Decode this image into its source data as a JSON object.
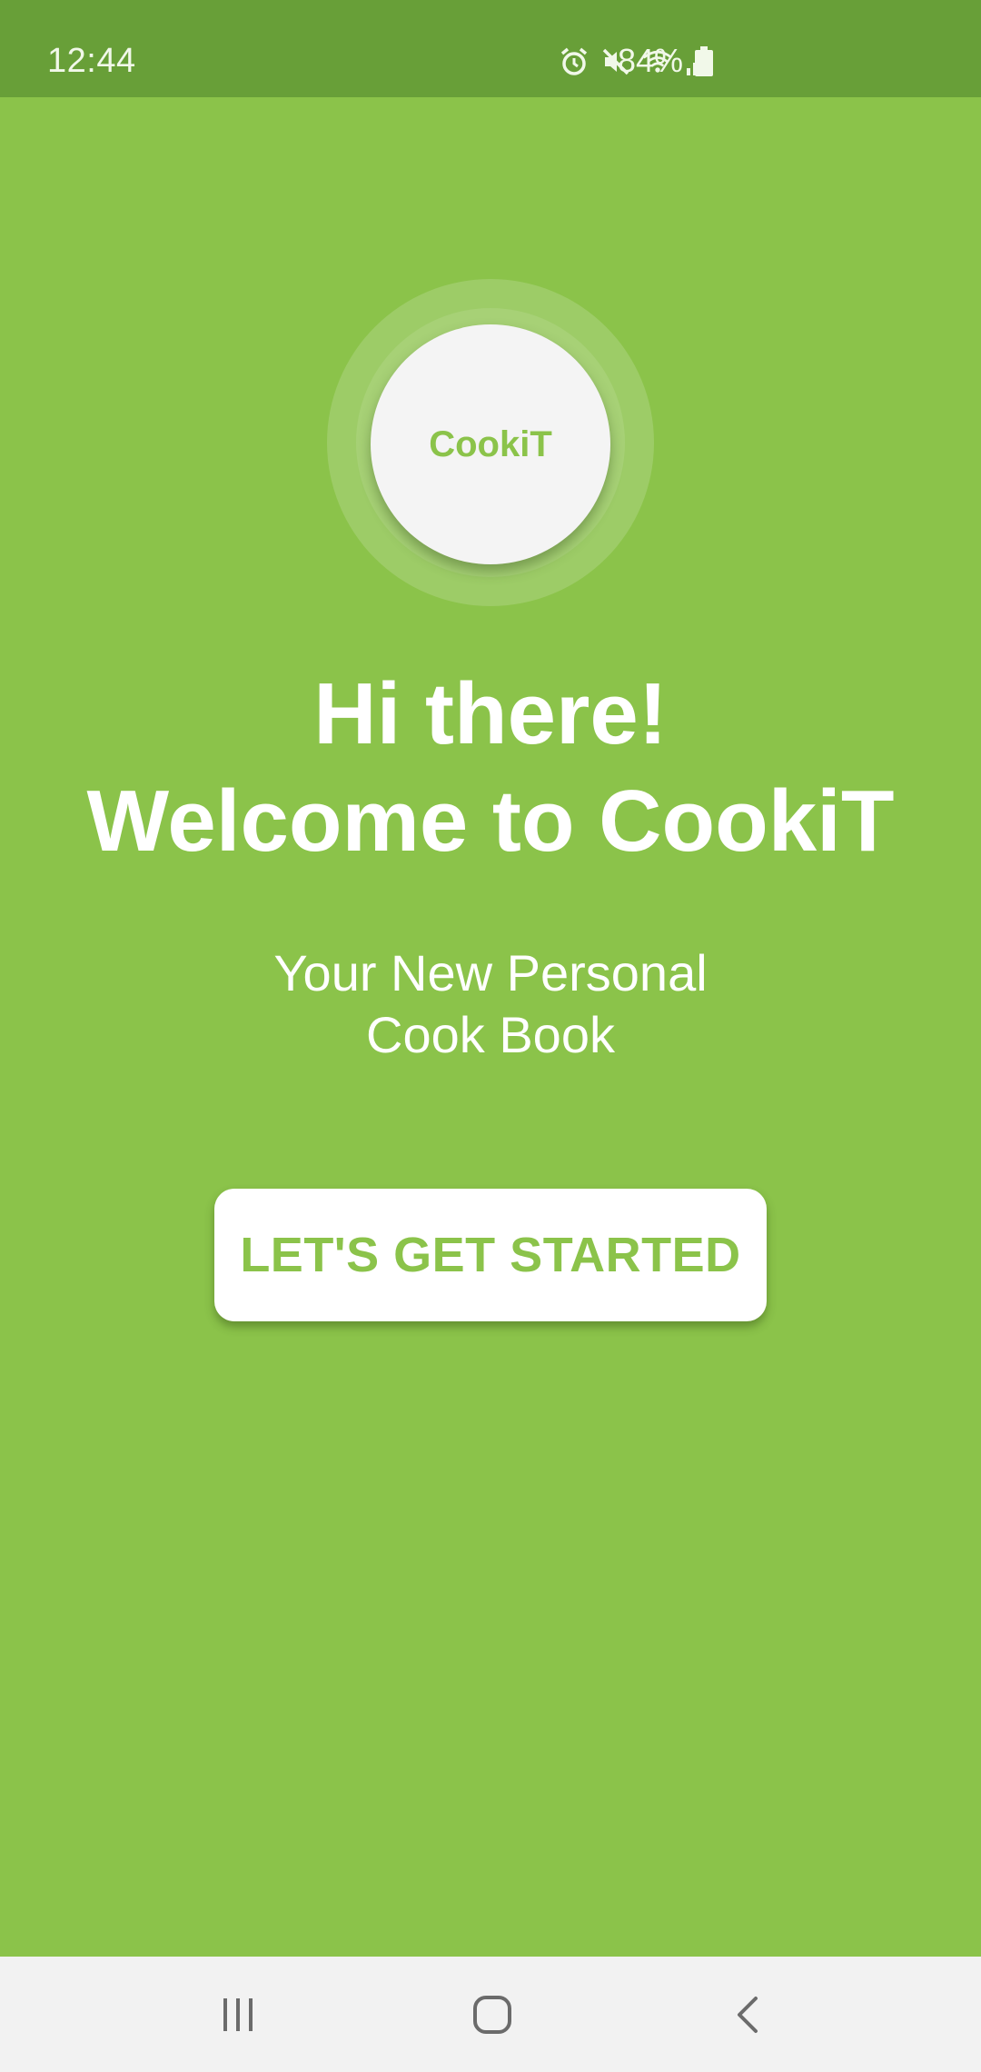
{
  "status_bar": {
    "time": "12:44",
    "battery": "84%",
    "icons": [
      "alarm-icon",
      "mute-icon",
      "wifi-icon",
      "signal-icon",
      "battery-icon"
    ]
  },
  "logo": {
    "text": "CookiT"
  },
  "welcome": {
    "line1": "Hi there!",
    "line2": "Welcome to CookiT"
  },
  "subtitle": {
    "line1": "Your New Personal",
    "line2": "Cook Book"
  },
  "cta": {
    "label": "LET'S GET STARTED"
  },
  "nav": {
    "icons": [
      "recent-apps-icon",
      "home-icon",
      "back-icon"
    ]
  },
  "colors": {
    "background": "#8bc34a",
    "status_bar": "#689f38",
    "accent_text": "#8bc34a",
    "nav_bar": "#f2f2f2"
  }
}
